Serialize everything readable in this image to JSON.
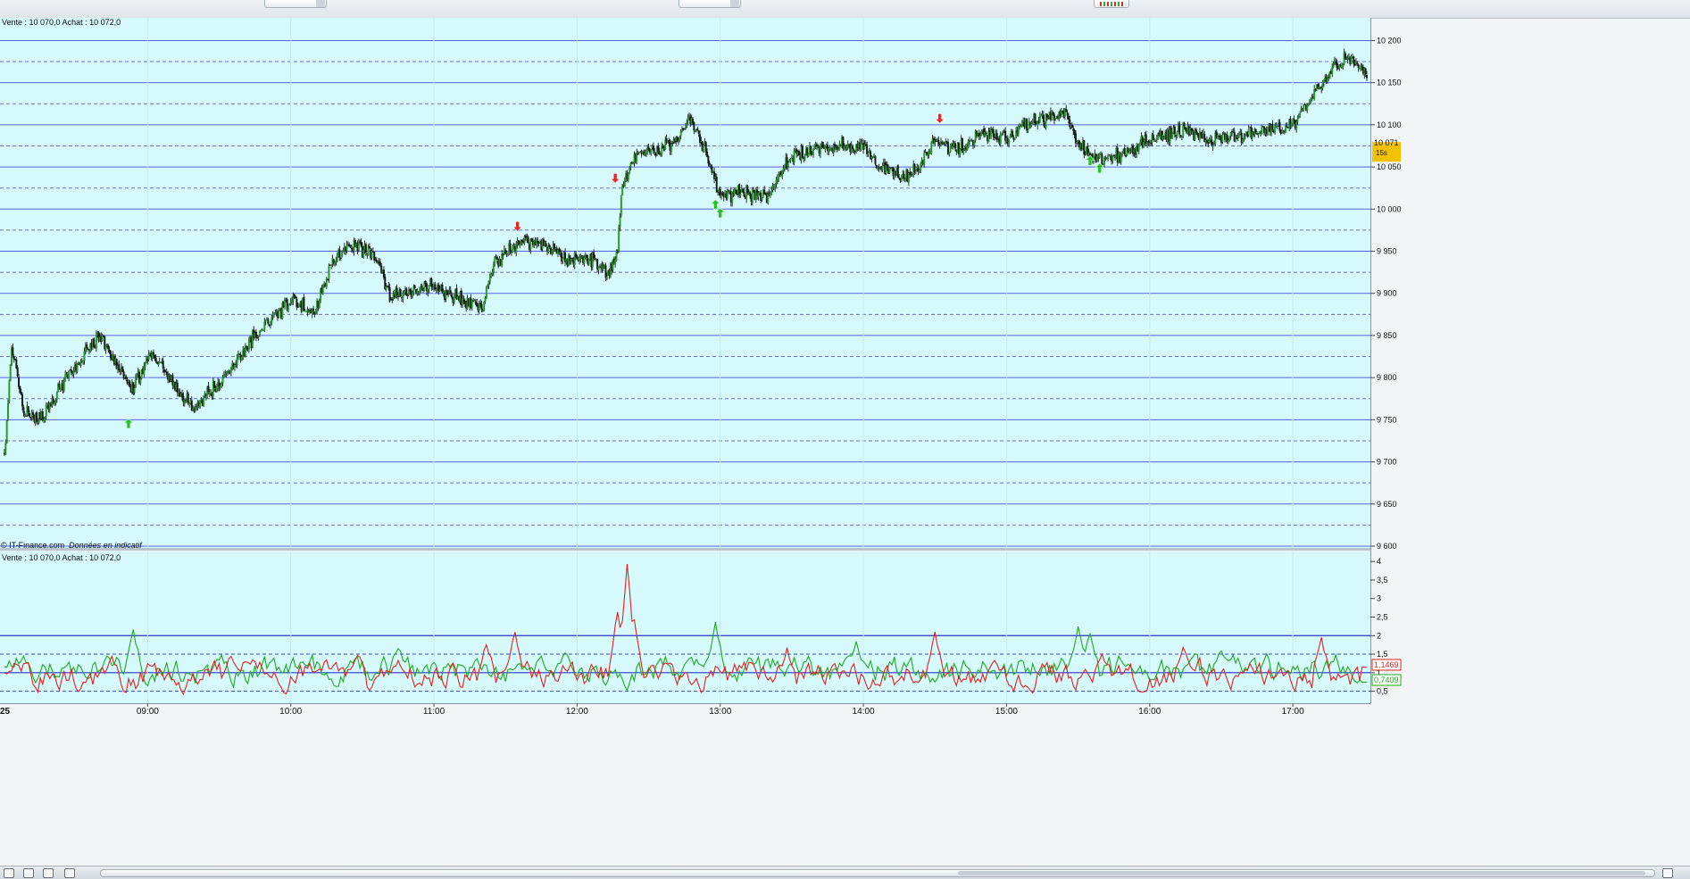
{
  "header": {
    "quote_text_top": "Vente : 10 070,0 Achat : 10 072,0",
    "quote_text_bottom": "Vente : 10 070,0 Achat : 10 072,0",
    "copyright": "© IT-Finance.com",
    "disclaimer": "Données en indicatif",
    "date_fragment": "25"
  },
  "last_price": {
    "value_label": "10 071",
    "period_label": "15s",
    "value": 10071
  },
  "indicator_labels": {
    "red": "1,1469",
    "green": "0,7409"
  },
  "colors": {
    "background": "#d6fafc",
    "grid_solid": "#5561e0",
    "grid_dashed": "#6a70c8",
    "bull": "#2a9a2a",
    "bear": "#1a1a1a",
    "red_line": "#e02020",
    "green_line": "#1ea81e",
    "badge": "#f2c200"
  },
  "chart_data": [
    {
      "type": "candlestick",
      "title": "",
      "x_tick_labels": [
        "09:00",
        "10:00",
        "11:00",
        "12:00",
        "13:00",
        "14:00",
        "15:00",
        "16:00",
        "17:00"
      ],
      "y_tick_labels": [
        "10 200",
        "10 150",
        "10 100",
        "10 050",
        "10 000",
        "9 950",
        "9 900",
        "9 850",
        "9 800",
        "9 750",
        "9 700",
        "9 650",
        "9 600"
      ],
      "y_ticks": [
        10200,
        10150,
        10100,
        10050,
        10000,
        9950,
        9900,
        9850,
        9800,
        9750,
        9700,
        9650,
        9600
      ],
      "ylim": [
        9600,
        10210
      ],
      "xlim": [
        "08:00",
        "17:31"
      ],
      "grid": {
        "solid_every": 50,
        "dashed_offset": 25
      },
      "price_path": [
        {
          "t": "08:00",
          "v": 9710
        },
        {
          "t": "08:03",
          "v": 9840
        },
        {
          "t": "08:08",
          "v": 9760
        },
        {
          "t": "08:15",
          "v": 9750
        },
        {
          "t": "08:25",
          "v": 9795
        },
        {
          "t": "08:40",
          "v": 9850
        },
        {
          "t": "08:53",
          "v": 9785
        },
        {
          "t": "09:02",
          "v": 9830
        },
        {
          "t": "09:12",
          "v": 9790
        },
        {
          "t": "09:20",
          "v": 9765
        },
        {
          "t": "09:32",
          "v": 9800
        },
        {
          "t": "09:45",
          "v": 9850
        },
        {
          "t": "10:00",
          "v": 9890
        },
        {
          "t": "10:10",
          "v": 9880
        },
        {
          "t": "10:18",
          "v": 9940
        },
        {
          "t": "10:25",
          "v": 9960
        },
        {
          "t": "10:35",
          "v": 9945
        },
        {
          "t": "10:42",
          "v": 9895
        },
        {
          "t": "11:00",
          "v": 9910
        },
        {
          "t": "11:12",
          "v": 9890
        },
        {
          "t": "11:20",
          "v": 9885
        },
        {
          "t": "11:25",
          "v": 9935
        },
        {
          "t": "11:35",
          "v": 9960
        },
        {
          "t": "11:45",
          "v": 9960
        },
        {
          "t": "11:55",
          "v": 9940
        },
        {
          "t": "12:05",
          "v": 9940
        },
        {
          "t": "12:13",
          "v": 9925
        },
        {
          "t": "12:17",
          "v": 9950
        },
        {
          "t": "12:19",
          "v": 10030
        },
        {
          "t": "12:25",
          "v": 10065
        },
        {
          "t": "12:35",
          "v": 10070
        },
        {
          "t": "12:42",
          "v": 10085
        },
        {
          "t": "12:48",
          "v": 10105
        },
        {
          "t": "12:55",
          "v": 10060
        },
        {
          "t": "13:00",
          "v": 10015
        },
        {
          "t": "13:10",
          "v": 10020
        },
        {
          "t": "13:20",
          "v": 10015
        },
        {
          "t": "13:30",
          "v": 10065
        },
        {
          "t": "13:45",
          "v": 10075
        },
        {
          "t": "14:00",
          "v": 10075
        },
        {
          "t": "14:10",
          "v": 10045
        },
        {
          "t": "14:20",
          "v": 10040
        },
        {
          "t": "14:30",
          "v": 10080
        },
        {
          "t": "14:40",
          "v": 10070
        },
        {
          "t": "14:50",
          "v": 10090
        },
        {
          "t": "15:00",
          "v": 10085
        },
        {
          "t": "15:07",
          "v": 10100
        },
        {
          "t": "15:15",
          "v": 10105
        },
        {
          "t": "15:25",
          "v": 10115
        },
        {
          "t": "15:30",
          "v": 10080
        },
        {
          "t": "15:36",
          "v": 10060
        },
        {
          "t": "15:45",
          "v": 10060
        },
        {
          "t": "15:55",
          "v": 10075
        },
        {
          "t": "16:05",
          "v": 10085
        },
        {
          "t": "16:15",
          "v": 10095
        },
        {
          "t": "16:25",
          "v": 10080
        },
        {
          "t": "16:35",
          "v": 10085
        },
        {
          "t": "16:45",
          "v": 10090
        },
        {
          "t": "17:00",
          "v": 10100
        },
        {
          "t": "17:10",
          "v": 10140
        },
        {
          "t": "17:18",
          "v": 10170
        },
        {
          "t": "17:23",
          "v": 10180
        },
        {
          "t": "17:31",
          "v": 10162
        }
      ],
      "signals": [
        {
          "t": "08:52",
          "type": "buy",
          "price": 9745
        },
        {
          "t": "11:35",
          "type": "sell",
          "price": 9980
        },
        {
          "t": "12:16",
          "type": "sell",
          "price": 10037
        },
        {
          "t": "12:58",
          "type": "buy",
          "price": 10005
        },
        {
          "t": "13:00",
          "type": "buy",
          "price": 9995
        },
        {
          "t": "14:32",
          "type": "sell",
          "price": 10108
        },
        {
          "t": "15:35",
          "type": "buy",
          "price": 10057
        },
        {
          "t": "15:39",
          "type": "buy",
          "price": 10048
        }
      ]
    },
    {
      "type": "line",
      "title": "",
      "y_tick_labels": [
        "4",
        "3,5",
        "3",
        "2,5",
        "2",
        "1,5",
        "1",
        "0,5"
      ],
      "y_ticks": [
        4,
        3.5,
        3,
        2.5,
        2,
        1.5,
        1,
        0.5
      ],
      "ylim": [
        0.25,
        4.1
      ],
      "grid": {
        "solid": [
          2,
          1
        ],
        "dashed": [
          1.5,
          0.5
        ]
      },
      "series": [
        {
          "color": "red",
          "baseline": 0.9,
          "spikes": [
            {
              "t": "08:05",
              "v": 1.3
            },
            {
              "t": "08:45",
              "v": 1.4
            },
            {
              "t": "09:35",
              "v": 1.5
            },
            {
              "t": "10:28",
              "v": 1.5
            },
            {
              "t": "11:22",
              "v": 1.8
            },
            {
              "t": "11:34",
              "v": 2.1
            },
            {
              "t": "12:17",
              "v": 2.7
            },
            {
              "t": "12:21",
              "v": 3.95
            },
            {
              "t": "12:24",
              "v": 2.4
            },
            {
              "t": "13:28",
              "v": 1.6
            },
            {
              "t": "14:30",
              "v": 2.1
            },
            {
              "t": "15:40",
              "v": 1.5
            },
            {
              "t": "16:14",
              "v": 1.7
            },
            {
              "t": "17:12",
              "v": 1.9
            }
          ],
          "last": 1.1469
        },
        {
          "color": "green",
          "baseline": 1.05,
          "spikes": [
            {
              "t": "08:54",
              "v": 2.1
            },
            {
              "t": "10:45",
              "v": 1.7
            },
            {
              "t": "11:55",
              "v": 1.6
            },
            {
              "t": "12:58",
              "v": 2.35
            },
            {
              "t": "13:57",
              "v": 1.8
            },
            {
              "t": "15:30",
              "v": 2.25
            },
            {
              "t": "15:35",
              "v": 2.1
            },
            {
              "t": "16:30",
              "v": 1.6
            }
          ],
          "last": 0.7409
        }
      ]
    }
  ]
}
